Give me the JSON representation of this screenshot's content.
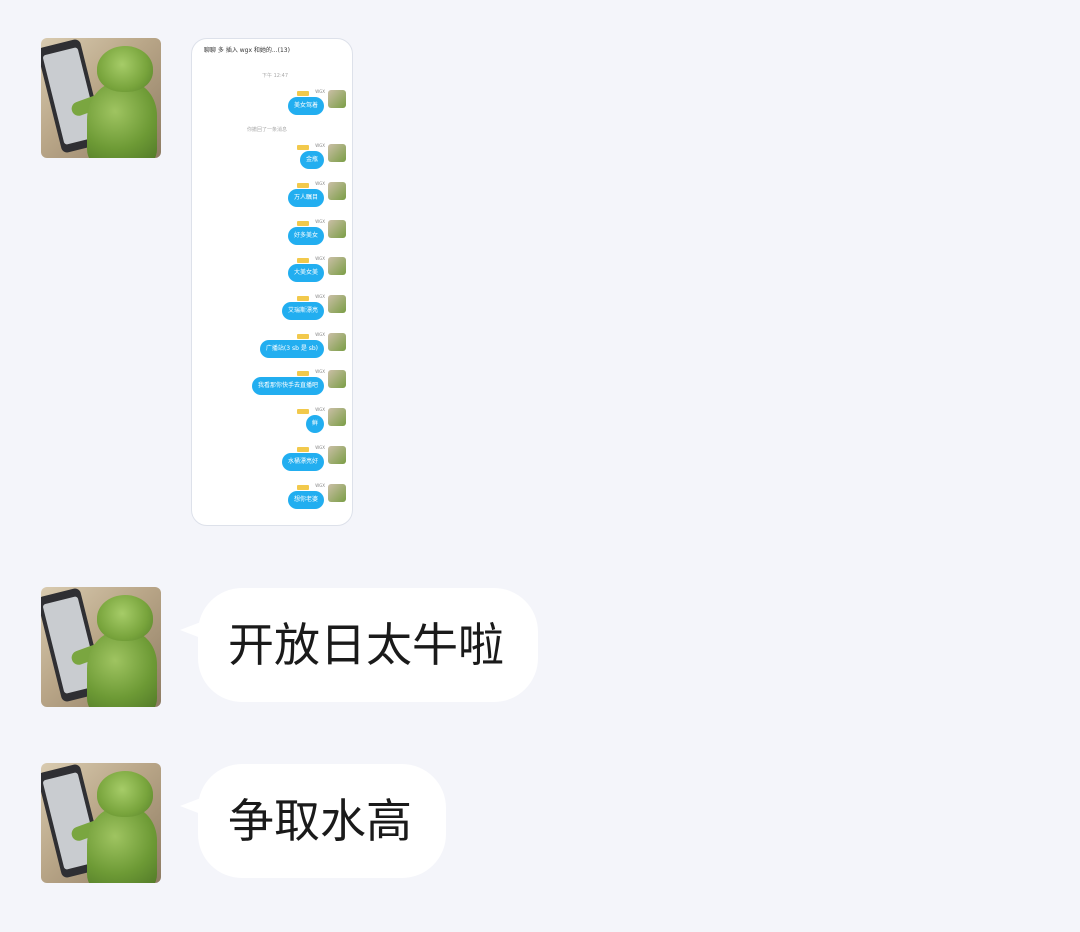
{
  "colors": {
    "background": "#f4f5fa",
    "bubble": "#ffffff",
    "inner_bubble": "#22aef0",
    "text": "#1a1a1a"
  },
  "messages": [
    {
      "type": "image",
      "avatar_icon": "kermit-frog-avatar-icon",
      "screenshot": {
        "title": "聊聊 多 插入 wgx 和她的...(13)",
        "time": "下午 12:47",
        "notice": "你撤回了一条消息",
        "sender_name": "WGX",
        "bubbles": [
          "美女驾着",
          "金瓶",
          "万人瞩目",
          "好多美女",
          "大美女美",
          "艾瑞斯漂亮",
          "广播站(3 sb 是 sb)",
          "我看那你快手去直播吧",
          "鲜",
          "水桶漂亮好",
          "想你老婆"
        ]
      }
    },
    {
      "type": "text",
      "avatar_icon": "kermit-frog-avatar-icon",
      "text": "开放日太牛啦"
    },
    {
      "type": "text",
      "avatar_icon": "kermit-frog-avatar-icon",
      "text": "争取水高"
    }
  ]
}
